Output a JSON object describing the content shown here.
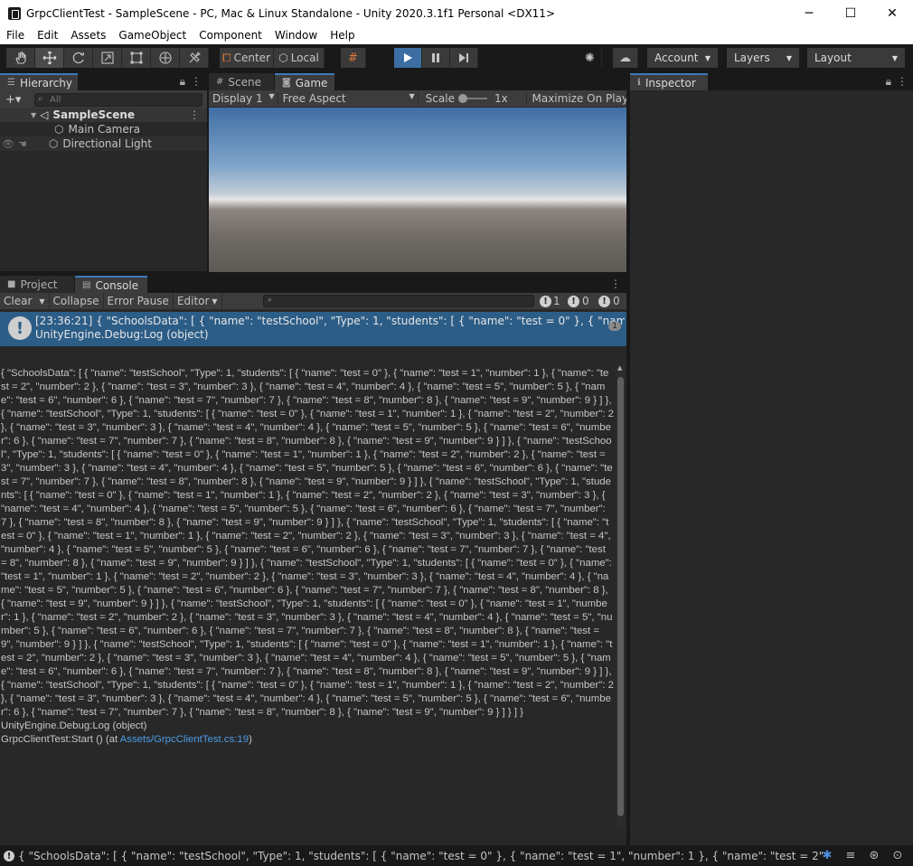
{
  "window": {
    "title": "GrpcClientTest - SampleScene - PC, Mac & Linux Standalone - Unity 2020.3.1f1 Personal <DX11>",
    "minimize": "─",
    "maximize": "☐",
    "close": "✕"
  },
  "menu": [
    "File",
    "Edit",
    "Assets",
    "GameObject",
    "Component",
    "Window",
    "Help"
  ],
  "toolbar": {
    "pivot_label": "Center",
    "space_label": "Local",
    "account_label": "Account",
    "layers_label": "Layers",
    "layout_label": "Layout"
  },
  "hierarchy": {
    "tab_label": "Hierarchy",
    "add_label": "+▾",
    "search_placeholder": "All",
    "scene_name": "SampleScene",
    "items": [
      "Main Camera",
      "Directional Light"
    ]
  },
  "scene_view": {
    "scene_tab": "Scene",
    "game_tab": "Game",
    "display_label": "Display 1",
    "aspect_label": "Free Aspect",
    "scale_label": "Scale",
    "scale_value": "1x",
    "maximize_label": "Maximize On Play"
  },
  "console": {
    "project_tab": "Project",
    "console_tab": "Console",
    "clear_label": "Clear",
    "collapse_label": "Collapse",
    "error_pause_label": "Error Pause",
    "editor_label": "Editor",
    "warn_count": "1",
    "info_count": "0",
    "error_count": "0",
    "entry_line1": "[23:36:21] { \"SchoolsData\": [ { \"name\": \"testSchool\", \"Type\": 1, \"students\": [ { \"name\": \"test = 0\" }, { \"name\": \"test = 1\", \"number\": 1 }, { \"name\": \"test = 2\"",
    "entry_line2": "UnityEngine.Debug:Log (object)",
    "entry_count": "1",
    "detail_json": "{ \"SchoolsData\": [ { \"name\": \"testSchool\", \"Type\": 1, \"students\": [ { \"name\": \"test = 0\" }, { \"name\": \"test = 1\", \"number\": 1 }, { \"name\": \"test = 2\", \"number\": 2 }, { \"name\": \"test = 3\", \"number\": 3 }, { \"name\": \"test = 4\", \"number\": 4 }, { \"name\": \"test = 5\", \"number\": 5 }, { \"name\": \"test = 6\", \"number\": 6 }, { \"name\": \"test = 7\", \"number\": 7 }, { \"name\": \"test = 8\", \"number\": 8 }, { \"name\": \"test = 9\", \"number\": 9 } ] }, { \"name\": \"testSchool\", \"Type\": 1, \"students\": [ { \"name\": \"test = 0\" }, { \"name\": \"test = 1\", \"number\": 1 }, { \"name\": \"test = 2\", \"number\": 2 }, { \"name\": \"test = 3\", \"number\": 3 }, { \"name\": \"test = 4\", \"number\": 4 }, { \"name\": \"test = 5\", \"number\": 5 }, { \"name\": \"test = 6\", \"number\": 6 }, { \"name\": \"test = 7\", \"number\": 7 }, { \"name\": \"test = 8\", \"number\": 8 }, { \"name\": \"test = 9\", \"number\": 9 } ] }, { \"name\": \"testSchool\", \"Type\": 1, \"students\": [ { \"name\": \"test = 0\" }, { \"name\": \"test = 1\", \"number\": 1 }, { \"name\": \"test = 2\", \"number\": 2 }, { \"name\": \"test = 3\", \"number\": 3 }, { \"name\": \"test = 4\", \"number\": 4 }, { \"name\": \"test = 5\", \"number\": 5 }, { \"name\": \"test = 6\", \"number\": 6 }, { \"name\": \"test = 7\", \"number\": 7 }, { \"name\": \"test = 8\", \"number\": 8 }, { \"name\": \"test = 9\", \"number\": 9 } ] }, { \"name\": \"testSchool\", \"Type\": 1, \"students\": [ { \"name\": \"test = 0\" }, { \"name\": \"test = 1\", \"number\": 1 }, { \"name\": \"test = 2\", \"number\": 2 }, { \"name\": \"test = 3\", \"number\": 3 }, { \"name\": \"test = 4\", \"number\": 4 }, { \"name\": \"test = 5\", \"number\": 5 }, { \"name\": \"test = 6\", \"number\": 6 }, { \"name\": \"test = 7\", \"number\": 7 }, { \"name\": \"test = 8\", \"number\": 8 }, { \"name\": \"test = 9\", \"number\": 9 } ] }, { \"name\": \"testSchool\", \"Type\": 1, \"students\": [ { \"name\": \"test = 0\" }, { \"name\": \"test = 1\", \"number\": 1 }, { \"name\": \"test = 2\", \"number\": 2 }, { \"name\": \"test = 3\", \"number\": 3 }, { \"name\": \"test = 4\", \"number\": 4 }, { \"name\": \"test = 5\", \"number\": 5 }, { \"name\": \"test = 6\", \"number\": 6 }, { \"name\": \"test = 7\", \"number\": 7 }, { \"name\": \"test = 8\", \"number\": 8 }, { \"name\": \"test = 9\", \"number\": 9 } ] }, { \"name\": \"testSchool\", \"Type\": 1, \"students\": [ { \"name\": \"test = 0\" }, { \"name\": \"test = 1\", \"number\": 1 }, { \"name\": \"test = 2\", \"number\": 2 }, { \"name\": \"test = 3\", \"number\": 3 }, { \"name\": \"test = 4\", \"number\": 4 }, { \"name\": \"test = 5\", \"number\": 5 }, { \"name\": \"test = 6\", \"number\": 6 }, { \"name\": \"test = 7\", \"number\": 7 }, { \"name\": \"test = 8\", \"number\": 8 }, { \"name\": \"test = 9\", \"number\": 9 } ] }, { \"name\": \"testSchool\", \"Type\": 1, \"students\": [ { \"name\": \"test = 0\" }, { \"name\": \"test = 1\", \"number\": 1 }, { \"name\": \"test = 2\", \"number\": 2 }, { \"name\": \"test = 3\", \"number\": 3 }, { \"name\": \"test = 4\", \"number\": 4 }, { \"name\": \"test = 5\", \"number\": 5 }, { \"name\": \"test = 6\", \"number\": 6 }, { \"name\": \"test = 7\", \"number\": 7 }, { \"name\": \"test = 8\", \"number\": 8 }, { \"name\": \"test = 9\", \"number\": 9 } ] }, { \"name\": \"testSchool\", \"Type\": 1, \"students\": [ { \"name\": \"test = 0\" }, { \"name\": \"test = 1\", \"number\": 1 }, { \"name\": \"test = 2\", \"number\": 2 }, { \"name\": \"test = 3\", \"number\": 3 }, { \"name\": \"test = 4\", \"number\": 4 }, { \"name\": \"test = 5\", \"number\": 5 }, { \"name\": \"test = 6\", \"number\": 6 }, { \"name\": \"test = 7\", \"number\": 7 }, { \"name\": \"test = 8\", \"number\": 8 }, { \"name\": \"test = 9\", \"number\": 9 } ] }, { \"name\": \"testSchool\", \"Type\": 1, \"students\": [ { \"name\": \"test = 0\" }, { \"name\": \"test = 1\", \"number\": 1 }, { \"name\": \"test = 2\", \"number\": 2 }, { \"name\": \"test = 3\", \"number\": 3 }, { \"name\": \"test = 4\", \"number\": 4 }, { \"name\": \"test = 5\", \"number\": 5 }, { \"name\": \"test = 6\", \"number\": 6 }, { \"name\": \"test = 7\", \"number\": 7 }, { \"name\": \"test = 8\", \"number\": 8 }, { \"name\": \"test = 9\", \"number\": 9 } ] } ] }",
    "detail_log_call": "UnityEngine.Debug:Log (object)",
    "detail_stack_prefix": "GrpcClientTest:Start () (at ",
    "detail_stack_link": "Assets/GrpcClientTest.cs:19",
    "detail_stack_suffix": ")"
  },
  "inspector": {
    "tab_label": "Inspector"
  },
  "status": {
    "icon": "!",
    "message": "{ \"SchoolsData\": [ { \"name\": \"testSchool\", \"Type\": 1, \"students\": [ { \"name\": \"test = 0\" }, { \"name\": \"test = 1\", \"number\": 1 }, { \"name\": \"test = 2\", \"number\": 2 }, {"
  },
  "colors": {
    "accent": "#3a79bb",
    "selection": "#2c5d87",
    "link": "#4c9ce6",
    "play": "#3d6ea3"
  }
}
